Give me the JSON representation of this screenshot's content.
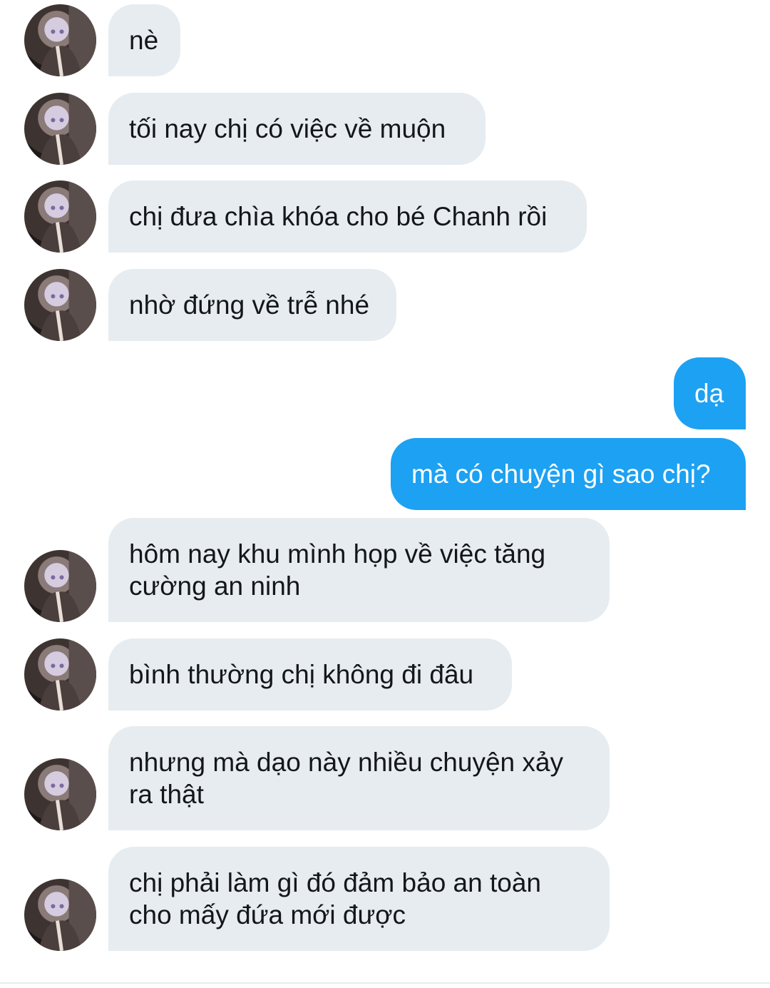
{
  "messages": [
    {
      "from": "them",
      "text": "nè"
    },
    {
      "from": "them",
      "text": "tối nay chị có việc về muộn"
    },
    {
      "from": "them",
      "text": "chị đưa chìa khóa cho bé Chanh rồi"
    },
    {
      "from": "them",
      "text": "nhờ đứng về trễ nhé"
    },
    {
      "from": "me",
      "text": "dạ"
    },
    {
      "from": "me",
      "text": "mà có chuyện gì sao chị?"
    },
    {
      "from": "them",
      "text": "hôm nay khu mình họp về việc tăng cường an ninh"
    },
    {
      "from": "them",
      "text": "bình thường chị không đi đâu"
    },
    {
      "from": "them",
      "text": "nhưng mà dạo này nhiều chuyện xảy ra thật"
    },
    {
      "from": "them",
      "text": "chị phải làm gì đó đảm bảo an toàn cho mấy đứa mới được"
    }
  ],
  "colors": {
    "incoming_bubble": "#e6ecf0",
    "outgoing_bubble": "#1da1f2",
    "incoming_text": "#14171a",
    "outgoing_text": "#ffffff"
  },
  "icons": {
    "avatar": "contact-avatar-icon"
  }
}
